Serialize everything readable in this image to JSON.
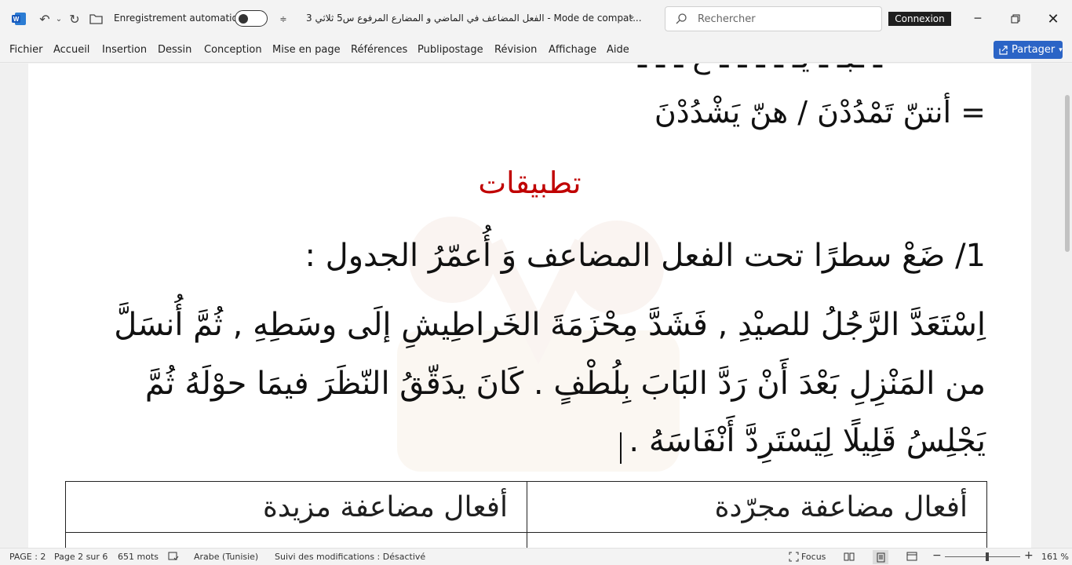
{
  "titlebar": {
    "app_icon": "word-icon",
    "autosave_label": "Enregistrement automatique",
    "doc_title": "الفعل المضاعف في الماضي و المضارع المرفوع س5 ثلاثي 3  -  Mode de compat...",
    "search_placeholder": "Rechercher",
    "signin_label": "Connexion"
  },
  "menu": {
    "items": [
      "Fichier",
      "Accueil",
      "Insertion",
      "Dessin",
      "Conception",
      "Mise en page",
      "Références",
      "Publipostage",
      "Révision",
      "Affichage",
      "Aide"
    ],
    "share_label": "Partager"
  },
  "document": {
    "top_cut_line": "ـ ـبـ ـ يـ ـ ـ ـ ـ ع ـ ـ ـ",
    "eq_line": "= أنتنّ تَمْدُدْنَ  /  هنّ يَشْدُدْنَ",
    "heading": "تطبيقات",
    "q1": "1/ ضَعْ سطرًا تحت الفعل المضاعف  وَ أُعمّرُ الجدول :",
    "para_lines": [
      "اِسْتَعَدَّ الرَّجُلُ للصيْدِ , فَشَدَّ مِحْزَمَةَ الخَراطِيشِ إلَى وسَطِهِ , ثُمَّ أُنسَلَّ",
      "من المَنْزِلِ بَعْدَ أَنْ رَدَّ البَابَ بِلُطْفٍ . كَانَ يدَقّقُ النّظَرَ فيمَا حوْلَهُ ثُمَّ",
      "يَجْلِسُ قَلِيلًا لِيَسْتَرِدَّ أَنْفَاسَهُ ."
    ],
    "table_headers": [
      "أفعال مضاعفة مجرّدة",
      "أفعال مضاعفة مزيدة"
    ]
  },
  "status": {
    "page": "PAGE : 2",
    "page_of": "Page 2 sur 6",
    "words": "651 mots",
    "language": "Arabe (Tunisie)",
    "track_changes": "Suivi des modifications : Désactivé",
    "focus": "Focus",
    "zoom": "161 %",
    "zoom_level_percent": 161
  },
  "colors": {
    "heading_red": "#c00000",
    "share_blue": "#2b64c6"
  }
}
